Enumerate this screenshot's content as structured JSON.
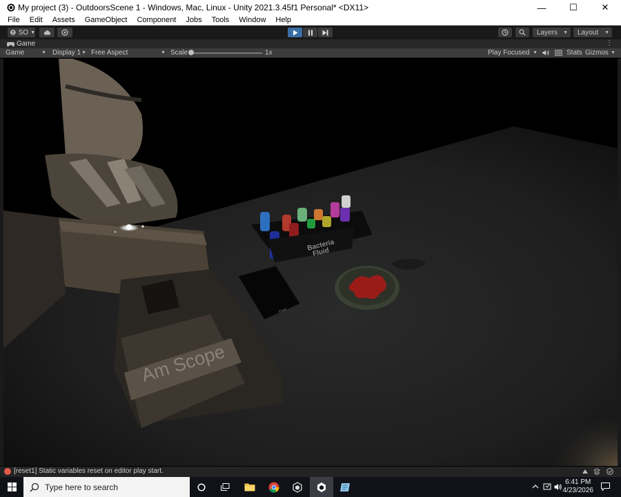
{
  "window": {
    "title": "My project (3) - OutdoorsScene 1 - Windows, Mac, Linux - Unity 2021.3.45f1 Personal* <DX11>",
    "minimize_glyph": "—",
    "maximize_glyph": "☐",
    "close_glyph": "✕"
  },
  "menu": [
    "File",
    "Edit",
    "Assets",
    "GameObject",
    "Component",
    "Jobs",
    "Tools",
    "Window",
    "Help"
  ],
  "toolbar": {
    "account_label": "SO",
    "layers_label": "Layers",
    "layout_label": "Layout",
    "accent_color": "#3b6ea5"
  },
  "game_tab": {
    "label": "Game",
    "view_dropdown": "Game",
    "display_dropdown": "Display 1",
    "aspect_dropdown": "Free Aspect",
    "scale_label": "Scale",
    "scale_value": "1x",
    "play_focused": "Play Focused",
    "stats_label": "Stats",
    "gizmos_label": "Gizmos"
  },
  "scene": {
    "microscope_brand": "Am Scope",
    "rack_label_line1": "Bacteria",
    "rack_label_line2": "Fluid",
    "box_label": "Fluid"
  },
  "console": {
    "message": "[reset1] Static variables reset on editor play start."
  },
  "taskbar": {
    "search_placeholder": "Type here to search",
    "time": "6:41 PM",
    "date": "4/23/2026"
  }
}
